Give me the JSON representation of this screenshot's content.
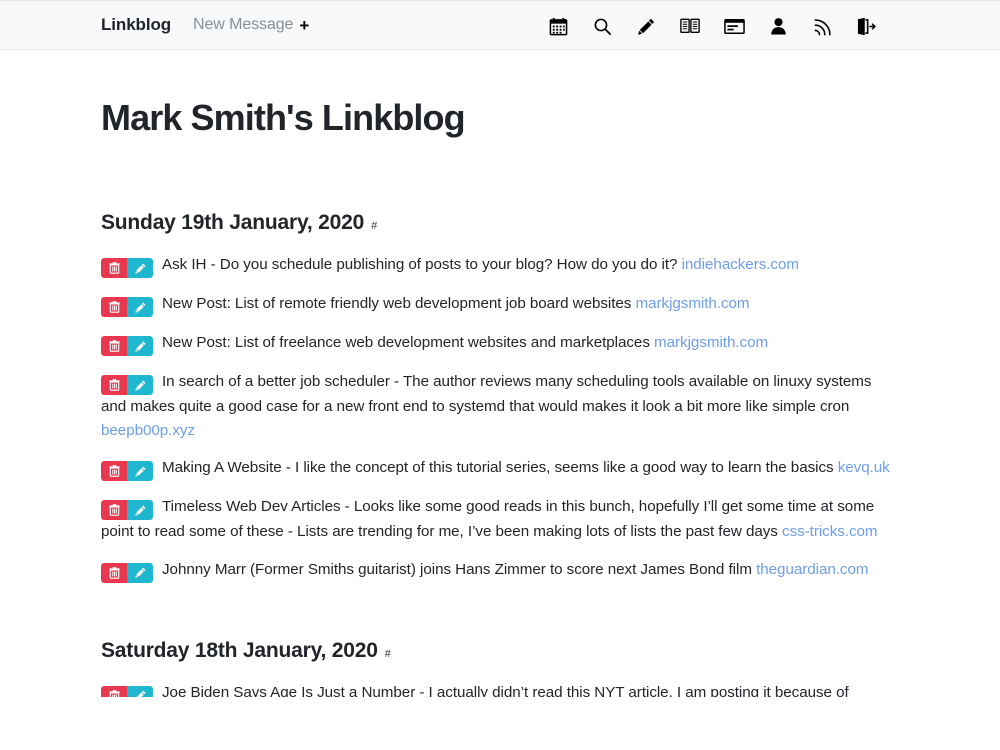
{
  "header": {
    "brand": "Linkblog",
    "new_message_label": "New Message",
    "new_message_plus": "+",
    "icons": [
      {
        "name": "calendar-icon",
        "label": "Calendar"
      },
      {
        "name": "search-icon",
        "label": "Search"
      },
      {
        "name": "pencil-icon",
        "label": "Write"
      },
      {
        "name": "book-icon",
        "label": "Reader"
      },
      {
        "name": "card-icon",
        "label": "Cards"
      },
      {
        "name": "person-icon",
        "label": "Profile"
      },
      {
        "name": "rss-icon",
        "label": "RSS feed"
      },
      {
        "name": "logout-icon",
        "label": "Log out"
      }
    ]
  },
  "page": {
    "title": "Mark Smith's Linkblog"
  },
  "colors": {
    "delete_button": "#e8384f",
    "edit_button": "#1fb6d0",
    "link": "#6d9eeb",
    "text": "#212529",
    "navbar_background": "#f8f9fa"
  },
  "buttons": {
    "delete_label": "Delete",
    "edit_label": "Edit"
  },
  "days": [
    {
      "heading": "Sunday 19th January, 2020",
      "anchor": "#",
      "links": [
        {
          "text": "Ask IH - Do you schedule publishing of posts to your blog? How do you do it?",
          "domain": "indiehackers.com"
        },
        {
          "text": "New Post: List of remote friendly web development job board websites",
          "domain": "markjgsmith.com"
        },
        {
          "text": "New Post: List of freelance web development websites and marketplaces",
          "domain": "markjgsmith.com"
        },
        {
          "text": "In search of a better job scheduler - The author reviews many scheduling tools available on linuxy systems and makes quite a good case for a new front end to systemd that would makes it look a bit more like simple cron",
          "domain": "beepb00p.xyz"
        },
        {
          "text": "Making A Website - I like the concept of this tutorial series, seems like a good way to learn the basics",
          "domain": "kevq.uk"
        },
        {
          "text": "Timeless Web Dev Articles - Looks like some good reads in this bunch, hopefully I’ll get some time at some point to read some of these - Lists are trending for me, I’ve been making lots of lists the past few days",
          "domain": "css-tricks.com"
        },
        {
          "text": "Johnny Marr (Former Smiths guitarist) joins Hans Zimmer to score next James Bond film",
          "domain": "theguardian.com"
        }
      ]
    },
    {
      "heading": "Saturday 18th January, 2020",
      "anchor": "#",
      "links": [
        {
          "text": "Joe Biden Says Age Is Just a Number - I actually didn’t read this NYT article, I am posting it because of",
          "domain": ""
        }
      ]
    }
  ]
}
